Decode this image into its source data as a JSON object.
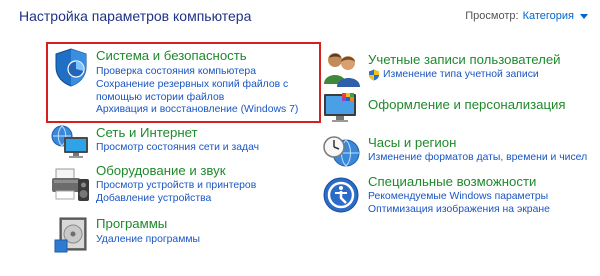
{
  "header": {
    "title": "Настройка параметров компьютера",
    "view_label": "Просмотр:",
    "view_value": "Категория"
  },
  "left_categories": [
    {
      "title": "Система и безопасность",
      "icon": "shield-security-icon",
      "links": [
        "Проверка состояния компьютера",
        "Сохранение резервных копий файлов с помощью истории файлов",
        "Архивация и восстановление (Windows 7)"
      ]
    },
    {
      "title": "Сеть и Интернет",
      "icon": "network-globe-icon",
      "links": [
        "Просмотр состояния сети и задач"
      ]
    },
    {
      "title": "Оборудование и звук",
      "icon": "printer-speaker-icon",
      "links": [
        "Просмотр устройств и принтеров",
        "Добавление устройства"
      ]
    },
    {
      "title": "Программы",
      "icon": "programs-disk-icon",
      "links": [
        "Удаление программы"
      ]
    }
  ],
  "right_categories": [
    {
      "title": "Учетные записи пользователей",
      "icon": "users-icon",
      "links": [
        "Изменение типа учетной записи"
      ]
    },
    {
      "title": "Оформление и персонализация",
      "icon": "monitor-palette-icon",
      "links": []
    },
    {
      "title": "Часы и регион",
      "icon": "clock-globe-icon",
      "links": [
        "Изменение форматов даты, времени и чисел"
      ]
    },
    {
      "title": "Специальные возможности",
      "icon": "accessibility-icon",
      "links": [
        "Рекомендуемые Windows параметры",
        "Оптимизация изображения на экране"
      ]
    }
  ],
  "colors": {
    "title": "#1e3287",
    "category_title": "#1e8a2c",
    "link": "#1a56c4",
    "highlight": "#d62020"
  }
}
